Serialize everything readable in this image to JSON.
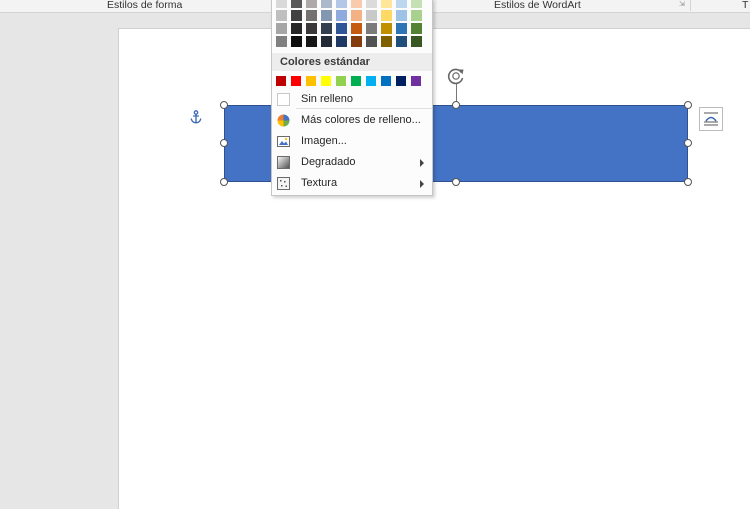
{
  "ribbon": {
    "group1_label": "Estilos de forma",
    "group2_label": "Estilos de WordArt",
    "group3_label": "T"
  },
  "menu": {
    "theme_colors_columns": [
      [
        "#f2f2f2",
        "#d9d9d9",
        "#bfbfbf",
        "#a6a6a6",
        "#808080"
      ],
      [
        "#808080",
        "#595959",
        "#404040",
        "#262626",
        "#0d0d0d"
      ],
      [
        "#d0cece",
        "#aeaaaa",
        "#757171",
        "#3a3838",
        "#171616"
      ],
      [
        "#d6dce4",
        "#adb9ca",
        "#8497b0",
        "#333f4f",
        "#222a35"
      ],
      [
        "#dae3f3",
        "#b4c7e7",
        "#8faadc",
        "#2f5597",
        "#1f3864"
      ],
      [
        "#fbe5d6",
        "#f8cbad",
        "#f4b183",
        "#c55a11",
        "#843c0c"
      ],
      [
        "#ededed",
        "#dbdbdb",
        "#c9c9c9",
        "#7b7b7b",
        "#525252"
      ],
      [
        "#fff2cc",
        "#ffe699",
        "#ffd966",
        "#bf9000",
        "#7f6000"
      ],
      [
        "#deebf7",
        "#bdd7ee",
        "#9dc3e6",
        "#2e75b6",
        "#1f4e79"
      ],
      [
        "#e2f0d9",
        "#c5e0b4",
        "#a9d18e",
        "#548235",
        "#385723"
      ]
    ],
    "standard_heading": "Colores estándar",
    "standard_colors": [
      "#c00000",
      "#ff0000",
      "#ffc000",
      "#ffff00",
      "#92d050",
      "#00b050",
      "#00b0f0",
      "#0070c0",
      "#002060",
      "#7030a0"
    ],
    "items": [
      {
        "label": "Sin relleno",
        "icon": "no-fill-icon"
      },
      {
        "label": "Más colores de relleno...",
        "icon": "color-wheel-icon"
      },
      {
        "label": "Imagen...",
        "icon": "picture-icon"
      },
      {
        "label": "Degradado",
        "icon": "gradient-icon",
        "submenu": true
      },
      {
        "label": "Textura",
        "icon": "texture-icon",
        "submenu": true
      }
    ]
  },
  "shape": {
    "fill": "#4472c4"
  }
}
